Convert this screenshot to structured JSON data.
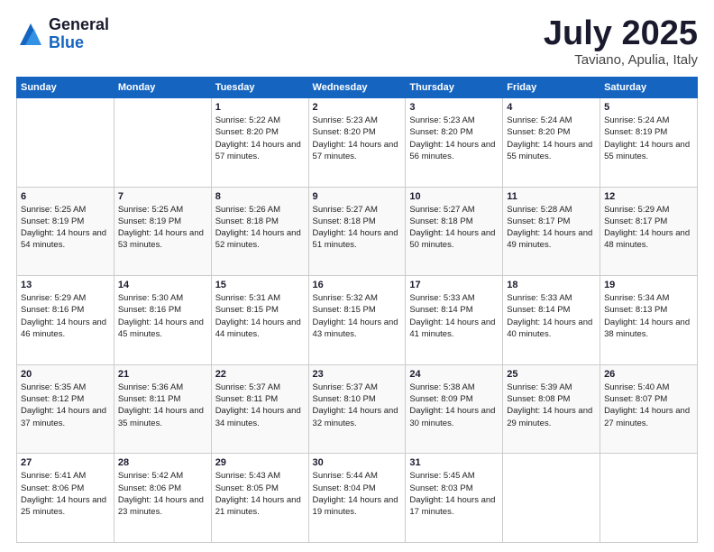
{
  "logo": {
    "general": "General",
    "blue": "Blue"
  },
  "title": "July 2025",
  "subtitle": "Taviano, Apulia, Italy",
  "days_of_week": [
    "Sunday",
    "Monday",
    "Tuesday",
    "Wednesday",
    "Thursday",
    "Friday",
    "Saturday"
  ],
  "weeks": [
    [
      {
        "day": "",
        "info": ""
      },
      {
        "day": "",
        "info": ""
      },
      {
        "day": "1",
        "info": "Sunrise: 5:22 AM\nSunset: 8:20 PM\nDaylight: 14 hours and 57 minutes."
      },
      {
        "day": "2",
        "info": "Sunrise: 5:23 AM\nSunset: 8:20 PM\nDaylight: 14 hours and 57 minutes."
      },
      {
        "day": "3",
        "info": "Sunrise: 5:23 AM\nSunset: 8:20 PM\nDaylight: 14 hours and 56 minutes."
      },
      {
        "day": "4",
        "info": "Sunrise: 5:24 AM\nSunset: 8:20 PM\nDaylight: 14 hours and 55 minutes."
      },
      {
        "day": "5",
        "info": "Sunrise: 5:24 AM\nSunset: 8:19 PM\nDaylight: 14 hours and 55 minutes."
      }
    ],
    [
      {
        "day": "6",
        "info": "Sunrise: 5:25 AM\nSunset: 8:19 PM\nDaylight: 14 hours and 54 minutes."
      },
      {
        "day": "7",
        "info": "Sunrise: 5:25 AM\nSunset: 8:19 PM\nDaylight: 14 hours and 53 minutes."
      },
      {
        "day": "8",
        "info": "Sunrise: 5:26 AM\nSunset: 8:18 PM\nDaylight: 14 hours and 52 minutes."
      },
      {
        "day": "9",
        "info": "Sunrise: 5:27 AM\nSunset: 8:18 PM\nDaylight: 14 hours and 51 minutes."
      },
      {
        "day": "10",
        "info": "Sunrise: 5:27 AM\nSunset: 8:18 PM\nDaylight: 14 hours and 50 minutes."
      },
      {
        "day": "11",
        "info": "Sunrise: 5:28 AM\nSunset: 8:17 PM\nDaylight: 14 hours and 49 minutes."
      },
      {
        "day": "12",
        "info": "Sunrise: 5:29 AM\nSunset: 8:17 PM\nDaylight: 14 hours and 48 minutes."
      }
    ],
    [
      {
        "day": "13",
        "info": "Sunrise: 5:29 AM\nSunset: 8:16 PM\nDaylight: 14 hours and 46 minutes."
      },
      {
        "day": "14",
        "info": "Sunrise: 5:30 AM\nSunset: 8:16 PM\nDaylight: 14 hours and 45 minutes."
      },
      {
        "day": "15",
        "info": "Sunrise: 5:31 AM\nSunset: 8:15 PM\nDaylight: 14 hours and 44 minutes."
      },
      {
        "day": "16",
        "info": "Sunrise: 5:32 AM\nSunset: 8:15 PM\nDaylight: 14 hours and 43 minutes."
      },
      {
        "day": "17",
        "info": "Sunrise: 5:33 AM\nSunset: 8:14 PM\nDaylight: 14 hours and 41 minutes."
      },
      {
        "day": "18",
        "info": "Sunrise: 5:33 AM\nSunset: 8:14 PM\nDaylight: 14 hours and 40 minutes."
      },
      {
        "day": "19",
        "info": "Sunrise: 5:34 AM\nSunset: 8:13 PM\nDaylight: 14 hours and 38 minutes."
      }
    ],
    [
      {
        "day": "20",
        "info": "Sunrise: 5:35 AM\nSunset: 8:12 PM\nDaylight: 14 hours and 37 minutes."
      },
      {
        "day": "21",
        "info": "Sunrise: 5:36 AM\nSunset: 8:11 PM\nDaylight: 14 hours and 35 minutes."
      },
      {
        "day": "22",
        "info": "Sunrise: 5:37 AM\nSunset: 8:11 PM\nDaylight: 14 hours and 34 minutes."
      },
      {
        "day": "23",
        "info": "Sunrise: 5:37 AM\nSunset: 8:10 PM\nDaylight: 14 hours and 32 minutes."
      },
      {
        "day": "24",
        "info": "Sunrise: 5:38 AM\nSunset: 8:09 PM\nDaylight: 14 hours and 30 minutes."
      },
      {
        "day": "25",
        "info": "Sunrise: 5:39 AM\nSunset: 8:08 PM\nDaylight: 14 hours and 29 minutes."
      },
      {
        "day": "26",
        "info": "Sunrise: 5:40 AM\nSunset: 8:07 PM\nDaylight: 14 hours and 27 minutes."
      }
    ],
    [
      {
        "day": "27",
        "info": "Sunrise: 5:41 AM\nSunset: 8:06 PM\nDaylight: 14 hours and 25 minutes."
      },
      {
        "day": "28",
        "info": "Sunrise: 5:42 AM\nSunset: 8:06 PM\nDaylight: 14 hours and 23 minutes."
      },
      {
        "day": "29",
        "info": "Sunrise: 5:43 AM\nSunset: 8:05 PM\nDaylight: 14 hours and 21 minutes."
      },
      {
        "day": "30",
        "info": "Sunrise: 5:44 AM\nSunset: 8:04 PM\nDaylight: 14 hours and 19 minutes."
      },
      {
        "day": "31",
        "info": "Sunrise: 5:45 AM\nSunset: 8:03 PM\nDaylight: 14 hours and 17 minutes."
      },
      {
        "day": "",
        "info": ""
      },
      {
        "day": "",
        "info": ""
      }
    ]
  ]
}
